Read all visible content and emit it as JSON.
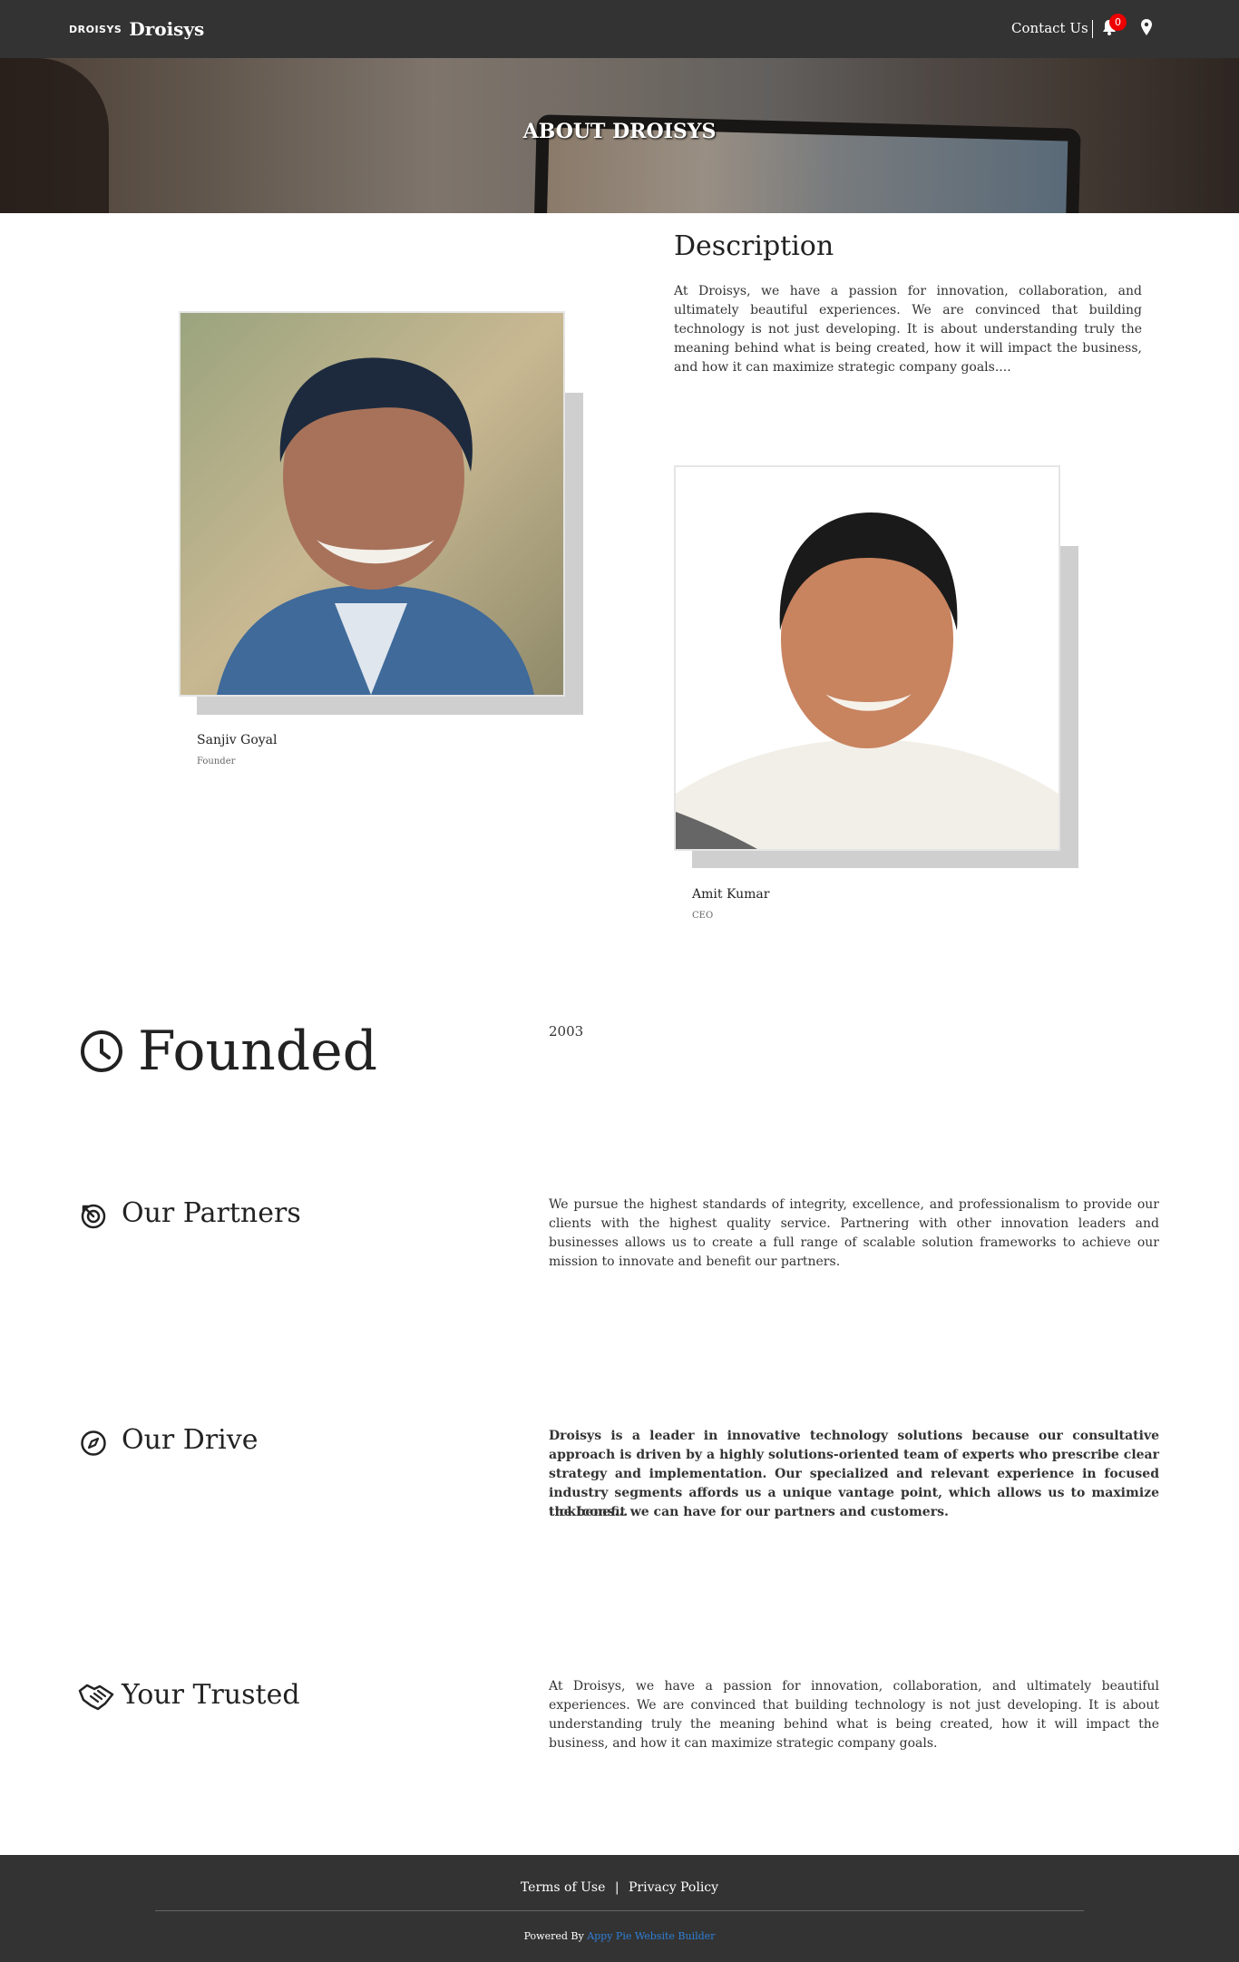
{
  "header": {
    "logo_mark": "DROISYS",
    "logo_name": "Droisys",
    "contact_label": "Contact Us",
    "notification_count": "0",
    "icons": [
      "bell-icon",
      "map-pin-icon"
    ]
  },
  "hero": {
    "title": "ABOUT DROISYS"
  },
  "people": [
    {
      "name": "Sanjiv Goyal",
      "role": "Founder"
    },
    {
      "name": "Amit Kumar",
      "role": "CEO"
    }
  ],
  "description": {
    "title": "Description",
    "text": "At Droisys, we have a passion for innovation, collaboration, and ultimately beautiful experiences. We are convinced that building technology is not just developing. It is about understanding truly the meaning behind what is being created, how it will impact the business, and how it can maximize strategic company goals...."
  },
  "founded": {
    "title": "Founded",
    "value": "2003",
    "icon": "clock-icon"
  },
  "partners": {
    "title": "Our Partners",
    "icon": "target-icon",
    "text": "We pursue the highest standards of integrity, excellence, and professionalism to provide our clients with the highest quality service. Partnering with other innovation leaders and businesses allows us to create a full range of scalable solution frameworks to achieve our mission to innovate and benefit our partners."
  },
  "drive": {
    "title": "Our Drive",
    "icon": "compass-icon",
    "text": "Droisys is a leader in innovative technology solutions because our consultative approach is driven by a highly solutions-oriented team of experts who prescribe clear strategy and implementation. Our specialized and relevant experience in focused industry segments affords us a unique vantage point, which allows us to maximize the benefit we can have for our partners and customers.",
    "text2": "tickIcons..."
  },
  "trusted": {
    "title": "Your Trusted",
    "icon": "handshake-icon",
    "text": "At Droisys, we have a passion for innovation, collaboration, and ultimately beautiful experiences. We are convinced that building technology is not just developing. It is about understanding truly the meaning behind what is being created, how it will impact the business, and how it can maximize strategic company goals."
  },
  "footer": {
    "terms": "Terms of Use",
    "separator": "|",
    "privacy": "Privacy Policy",
    "powered_prefix": "Powered By",
    "powered_link": "Appy Pie Website Builder"
  }
}
